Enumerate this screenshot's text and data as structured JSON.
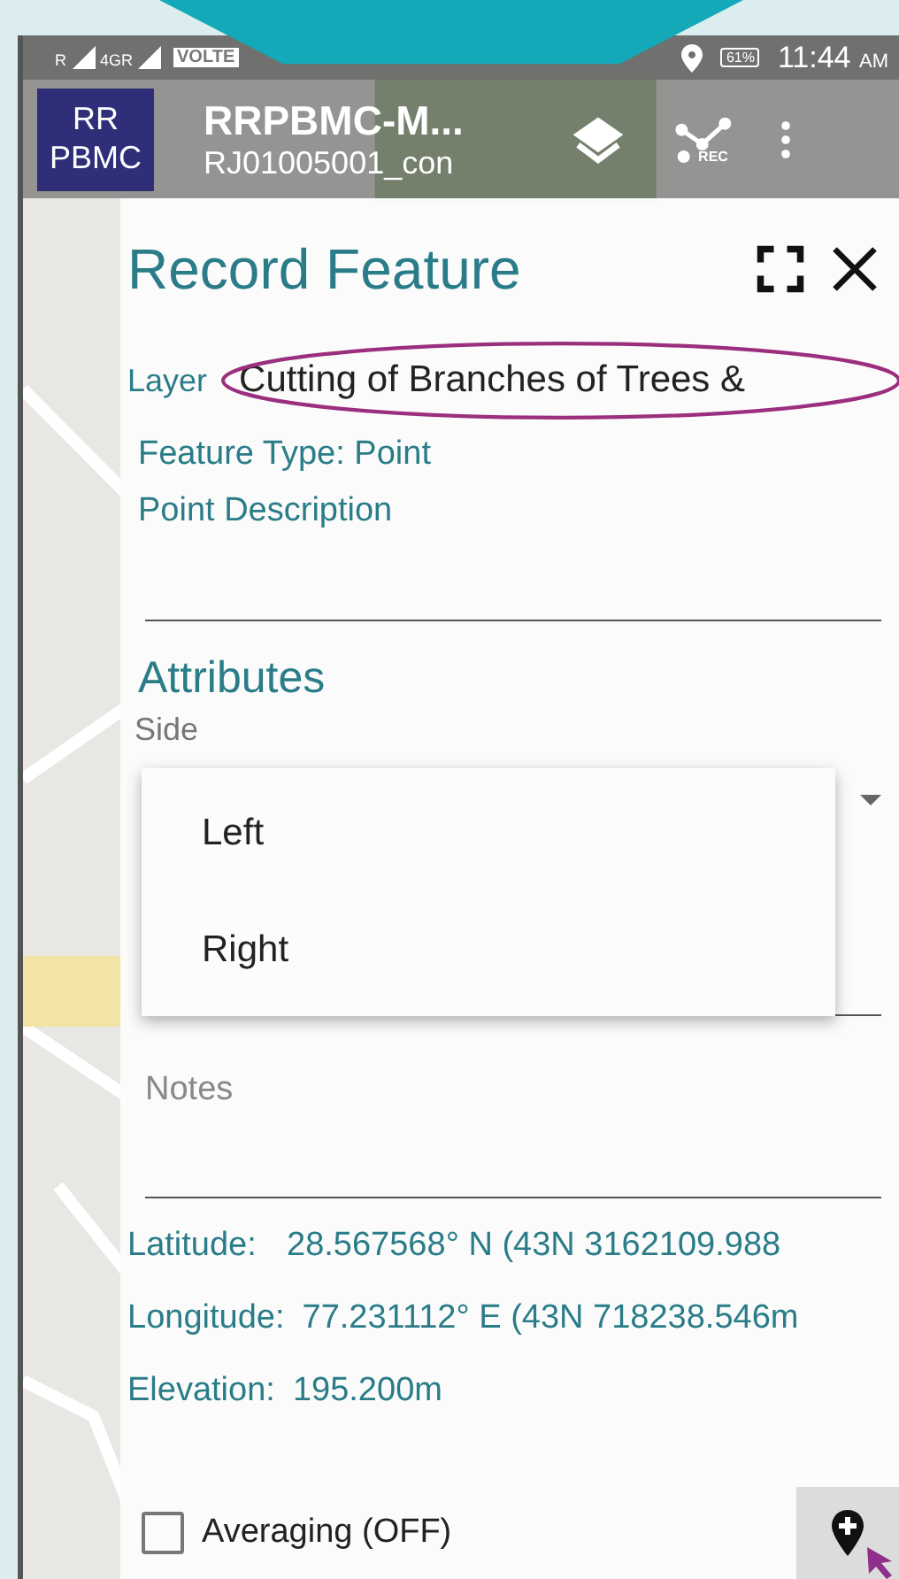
{
  "status_bar": {
    "signal_labels": [
      "R",
      "4GR"
    ],
    "volte": "VOLTE",
    "battery": "61%",
    "time": "11:44",
    "meridiem": "AM"
  },
  "app_bar": {
    "logo": [
      "RR",
      "PBMC"
    ],
    "title": "RRPBMC-M...",
    "subtitle": "RJ01005001_con",
    "rec_label": "REC"
  },
  "panel": {
    "title": "Record Feature",
    "layer": {
      "label": "Layer",
      "value": "Cutting of Branches of Trees &"
    },
    "feature_type": "Feature Type: Point",
    "description": {
      "label": "Point Description"
    },
    "attributes": {
      "heading": "Attributes",
      "fields": [
        {
          "kind": "select",
          "label": "Side",
          "expanded": true,
          "options": [
            {
              "label": "Left",
              "selected": false
            },
            {
              "label": "Right",
              "selected": false
            }
          ]
        },
        {
          "kind": "text",
          "placeholder": "Notes"
        }
      ]
    },
    "location": [
      {
        "label": "Latitude:",
        "value": "28.567568° N (43N 3162109.988"
      },
      {
        "label": "Longitude:",
        "value": "77.231112° E (43N 718238.546m"
      },
      {
        "label": "Elevation:",
        "value": "195.200m"
      }
    ],
    "averaging": {
      "label": "Averaging (OFF)",
      "checked": false
    }
  }
}
